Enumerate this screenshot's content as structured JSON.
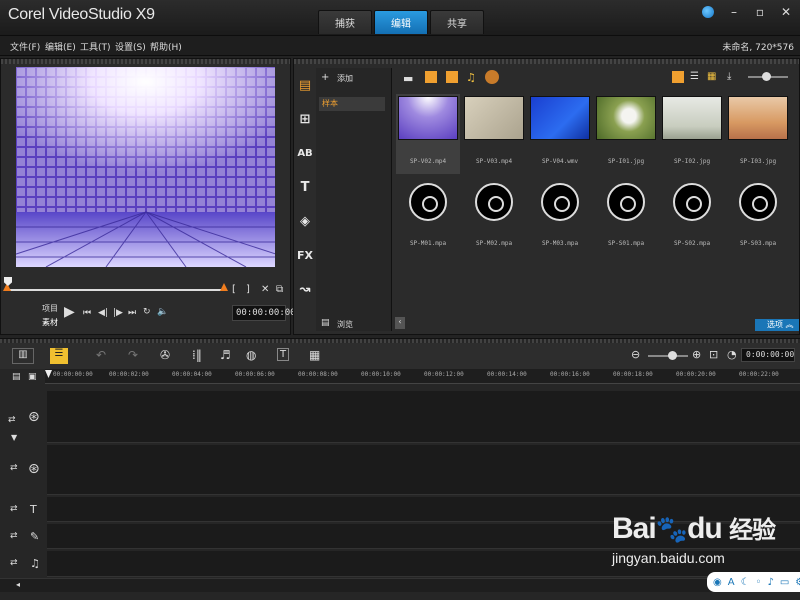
{
  "app": {
    "title": "Corel VideoStudio X9"
  },
  "tabs": [
    "捕获",
    "编辑",
    "共享"
  ],
  "menu": [
    "文件(F)",
    "编辑(E)",
    "工具(T)",
    "设置(S)",
    "帮助(H)"
  ],
  "project_info": "未命名, 720*576",
  "preview": {
    "mode_project": "项目",
    "mode_clip": "素材",
    "timecode": "00:00:00:00",
    "bracket_in": "[",
    "bracket_out": "]"
  },
  "library": {
    "add_label": "添加",
    "folder_label": "样本",
    "browse_label": "浏览",
    "options_label": "选项",
    "items": [
      {
        "name": "SP-V02.mp4",
        "kind": "video-lights"
      },
      {
        "name": "SP-V03.mp4",
        "kind": "video-beige"
      },
      {
        "name": "SP-V04.wmv",
        "kind": "video-blue"
      },
      {
        "name": "SP-I01.jpg",
        "kind": "image-dandelion"
      },
      {
        "name": "SP-I02.jpg",
        "kind": "image-tree"
      },
      {
        "name": "SP-I03.jpg",
        "kind": "image-desert"
      },
      {
        "name": "SP-M01.mpa",
        "kind": "audio"
      },
      {
        "name": "SP-M02.mpa",
        "kind": "audio"
      },
      {
        "name": "SP-M03.mpa",
        "kind": "audio"
      },
      {
        "name": "SP-S01.mpa",
        "kind": "audio"
      },
      {
        "name": "SP-S02.mpa",
        "kind": "audio"
      },
      {
        "name": "SP-S03.mpa",
        "kind": "audio"
      }
    ]
  },
  "timeline": {
    "timecode": "0:00:00:00",
    "ruler": [
      "00:00:00:00",
      "00:00:02:00",
      "00:00:04:00",
      "00:00:06:00",
      "00:00:08:00",
      "00:00:10:00",
      "00:00:12:00",
      "00:00:14:00",
      "00:00:16:00",
      "00:00:18:00",
      "00:00:20:00",
      "00:00:22:00"
    ]
  },
  "watermark": {
    "brand": "Bai",
    "brand2": "du",
    "cn": "经验",
    "url": "jingyan.baidu.com"
  },
  "colors": {
    "accent": "#1a8ad4",
    "marker": "#f07d1e",
    "folder_text": "#f0a030"
  }
}
